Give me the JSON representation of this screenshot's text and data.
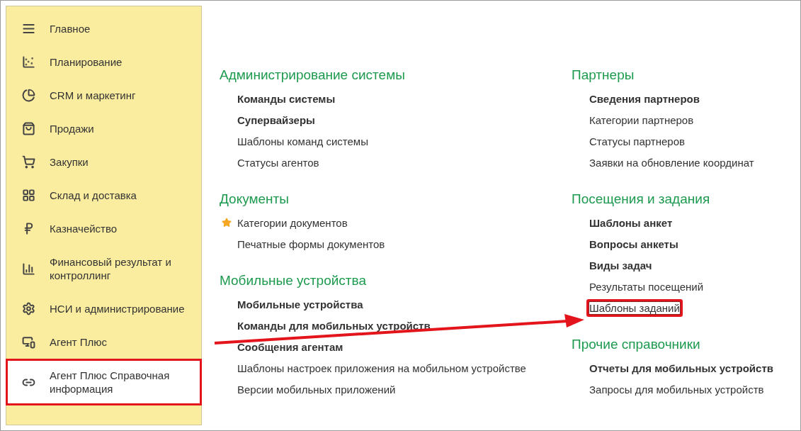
{
  "sidebar": {
    "items": [
      {
        "label": "Главное",
        "selected": false
      },
      {
        "label": "Планирование",
        "selected": false
      },
      {
        "label": "CRM и маркетинг",
        "selected": false
      },
      {
        "label": "Продажи",
        "selected": false
      },
      {
        "label": "Закупки",
        "selected": false
      },
      {
        "label": "Склад и доставка",
        "selected": false
      },
      {
        "label": "Казначейство",
        "selected": false
      },
      {
        "label": "Финансовый результат и контроллинг",
        "selected": false
      },
      {
        "label": "НСИ и администрирование",
        "selected": false
      },
      {
        "label": "Агент Плюс",
        "selected": false
      },
      {
        "label": "Агент Плюс Справочная информация",
        "selected": true
      }
    ]
  },
  "columns": [
    {
      "sections": [
        {
          "title": "Администрирование системы",
          "items": [
            {
              "label": "Команды системы",
              "bold": true,
              "favorite": false,
              "focused": false
            },
            {
              "label": "Супервайзеры",
              "bold": true,
              "favorite": false,
              "focused": false
            },
            {
              "label": "Шаблоны команд системы",
              "bold": false,
              "favorite": false,
              "focused": false
            },
            {
              "label": "Статусы агентов",
              "bold": false,
              "favorite": false,
              "focused": false
            }
          ]
        },
        {
          "title": "Документы",
          "items": [
            {
              "label": "Категории документов",
              "bold": false,
              "favorite": true,
              "focused": false
            },
            {
              "label": "Печатные формы документов",
              "bold": false,
              "favorite": false,
              "focused": false
            }
          ]
        },
        {
          "title": "Мобильные устройства",
          "items": [
            {
              "label": "Мобильные устройства",
              "bold": true,
              "favorite": false,
              "focused": false
            },
            {
              "label": "Команды для мобильных устройств",
              "bold": true,
              "favorite": false,
              "focused": false
            },
            {
              "label": "Сообщения агентам",
              "bold": true,
              "favorite": false,
              "focused": false
            },
            {
              "label": "Шаблоны настроек приложения на мобильном устройстве",
              "bold": false,
              "favorite": false,
              "focused": false
            },
            {
              "label": "Версии мобильных приложений",
              "bold": false,
              "favorite": false,
              "focused": false
            }
          ]
        }
      ]
    },
    {
      "sections": [
        {
          "title": "Партнеры",
          "items": [
            {
              "label": "Сведения партнеров",
              "bold": true,
              "favorite": false,
              "focused": false
            },
            {
              "label": "Категории партнеров",
              "bold": false,
              "favorite": false,
              "focused": false
            },
            {
              "label": "Статусы партнеров",
              "bold": false,
              "favorite": false,
              "focused": false
            },
            {
              "label": "Заявки на обновление координат",
              "bold": false,
              "favorite": false,
              "focused": false
            }
          ]
        },
        {
          "title": "Посещения и задания",
          "items": [
            {
              "label": "Шаблоны анкет",
              "bold": true,
              "favorite": false,
              "focused": false
            },
            {
              "label": "Вопросы анкеты",
              "bold": true,
              "favorite": false,
              "focused": false
            },
            {
              "label": "Виды задач",
              "bold": true,
              "favorite": false,
              "focused": false
            },
            {
              "label": "Результаты посещений",
              "bold": false,
              "favorite": false,
              "focused": false
            },
            {
              "label": "Шаблоны заданий",
              "bold": false,
              "favorite": false,
              "focused": true
            }
          ]
        },
        {
          "title": "Прочие справочники",
          "items": [
            {
              "label": "Отчеты для мобильных устройств",
              "bold": true,
              "favorite": false,
              "focused": false
            },
            {
              "label": "Запросы для мобильных устройств",
              "bold": false,
              "favorite": false,
              "focused": false
            }
          ]
        }
      ]
    }
  ]
}
